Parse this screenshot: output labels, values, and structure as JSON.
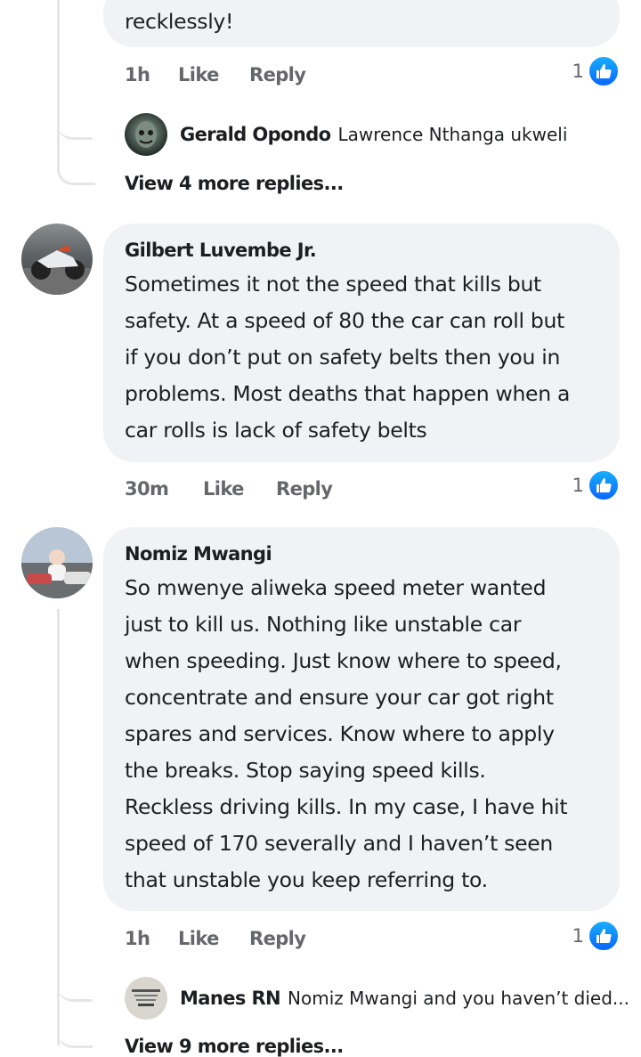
{
  "colors": {
    "bubble": "#f0f2f5",
    "meta": "#65676b",
    "like_blue": "#0866ff",
    "thread_line": "#e4e6eb"
  },
  "comment0": {
    "text_end": "recklessly!",
    "time": "1h",
    "like_label": "Like",
    "reply_label": "Reply",
    "reaction_count": "1",
    "reply": {
      "author": "Gerald Opondo",
      "text": "Lawrence Nthanga ukweli"
    },
    "more_replies": "View 4 more replies..."
  },
  "comment1": {
    "author": "Gilbert Luvembe Jr.",
    "lines": [
      "Sometimes it not the speed that kills but",
      "safety. At a speed of 80 the car can roll but",
      "if you don’t put on safety belts then you in",
      "problems. Most deaths that happen when a",
      "car rolls is lack of safety belts"
    ],
    "time": "30m",
    "like_label": "Like",
    "reply_label": "Reply",
    "reaction_count": "1"
  },
  "comment2": {
    "author": "Nomiz Mwangi",
    "lines": [
      "So mwenye aliweka speed meter wanted",
      "just to kill us. Nothing like unstable car",
      "when speeding. Just know where to speed,",
      "concentrate and ensure your car got right",
      "spares and services. Know where to apply",
      "the breaks. Stop saying speed kills.",
      "Reckless driving kills. In my case, I have hit",
      "speed of 170 severally and I haven’t seen",
      "that unstable you keep referring to."
    ],
    "time": "1h",
    "like_label": "Like",
    "reply_label": "Reply",
    "reaction_count": "1",
    "reply": {
      "author": "Manes RN",
      "text": "Nomiz Mwangi and you haven’t died..."
    },
    "more_replies": "View 9 more replies..."
  }
}
